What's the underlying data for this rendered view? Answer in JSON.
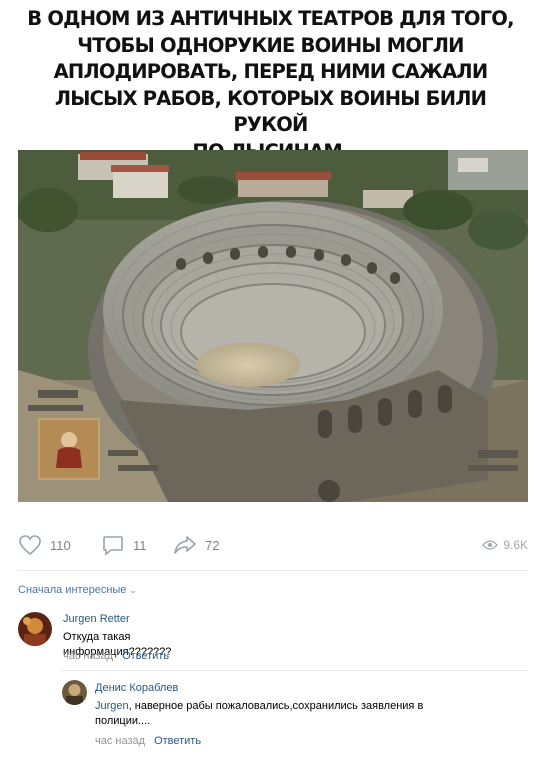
{
  "meme": {
    "title_lines": [
      "В ОДНОМ ИЗ АНТИЧНЫХ ТЕАТРОВ ДЛЯ ТОГО,",
      "ЧТОБЫ ОДНОРУКИЕ ВОИНЫ МОГЛИ",
      "АПЛОДИРОВАТЬ, ПЕРЕД НИМИ САЖАЛИ",
      "ЛЫСЫХ РАБОВ, КОТОРЫХ ВОИНЫ БИЛИ РУКОЙ",
      "ПО ЛЫСИНАМ."
    ]
  },
  "post": {
    "likes": "110",
    "comments": "11",
    "shares": "72",
    "views": "9.6K"
  },
  "comments_section": {
    "sort_label": "Сначала интересные",
    "items": [
      {
        "author": "Jurgen Retter",
        "text": "Откуда такая информация???????",
        "time": "час назад",
        "reply_label": "Ответить"
      },
      {
        "author": "Денис Кораблев",
        "mention": "Jurgen",
        "text_line1": ", наверное рабы пожаловались,сохранились заявления в",
        "text_line2": "полиции....",
        "time": "час назад",
        "reply_label": "Ответить"
      }
    ]
  },
  "colors": {
    "link": "#2a5885",
    "muted": "#828282",
    "divider": "#e7e8ec"
  },
  "icons": [
    "heart-icon",
    "comment-icon",
    "share-icon",
    "eye-icon",
    "chevron-down-icon"
  ]
}
